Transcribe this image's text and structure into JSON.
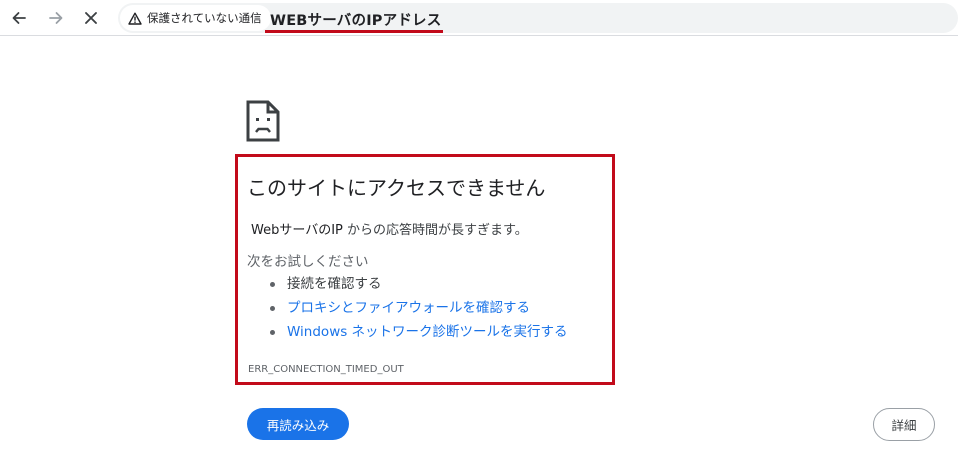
{
  "toolbar": {
    "back_icon": "arrow-left-icon",
    "forward_icon": "arrow-right-icon",
    "stop_icon": "close-icon",
    "security_icon": "warning-icon",
    "security_label": "保護されていない通信",
    "url": "WEBサーバのIPアドレス"
  },
  "error_page": {
    "icon": "sad-page-icon",
    "title": "このサイトにアクセスできません",
    "message_host": "WebサーバのIP",
    "message_rest": " からの応答時間が長すぎます。",
    "try_heading": "次をお試しください",
    "suggestions": [
      "接続を確認する",
      "プロキシとファイアウォールを確認する",
      "Windows ネットワーク診断ツールを実行する"
    ],
    "error_code": "ERR_CONNECTION_TIMED_OUT",
    "reload_label": "再読み込み",
    "details_label": "詳細"
  },
  "colors": {
    "highlight": "#c20a1a",
    "link": "#1a73e8",
    "primary_button": "#1a73e8"
  }
}
